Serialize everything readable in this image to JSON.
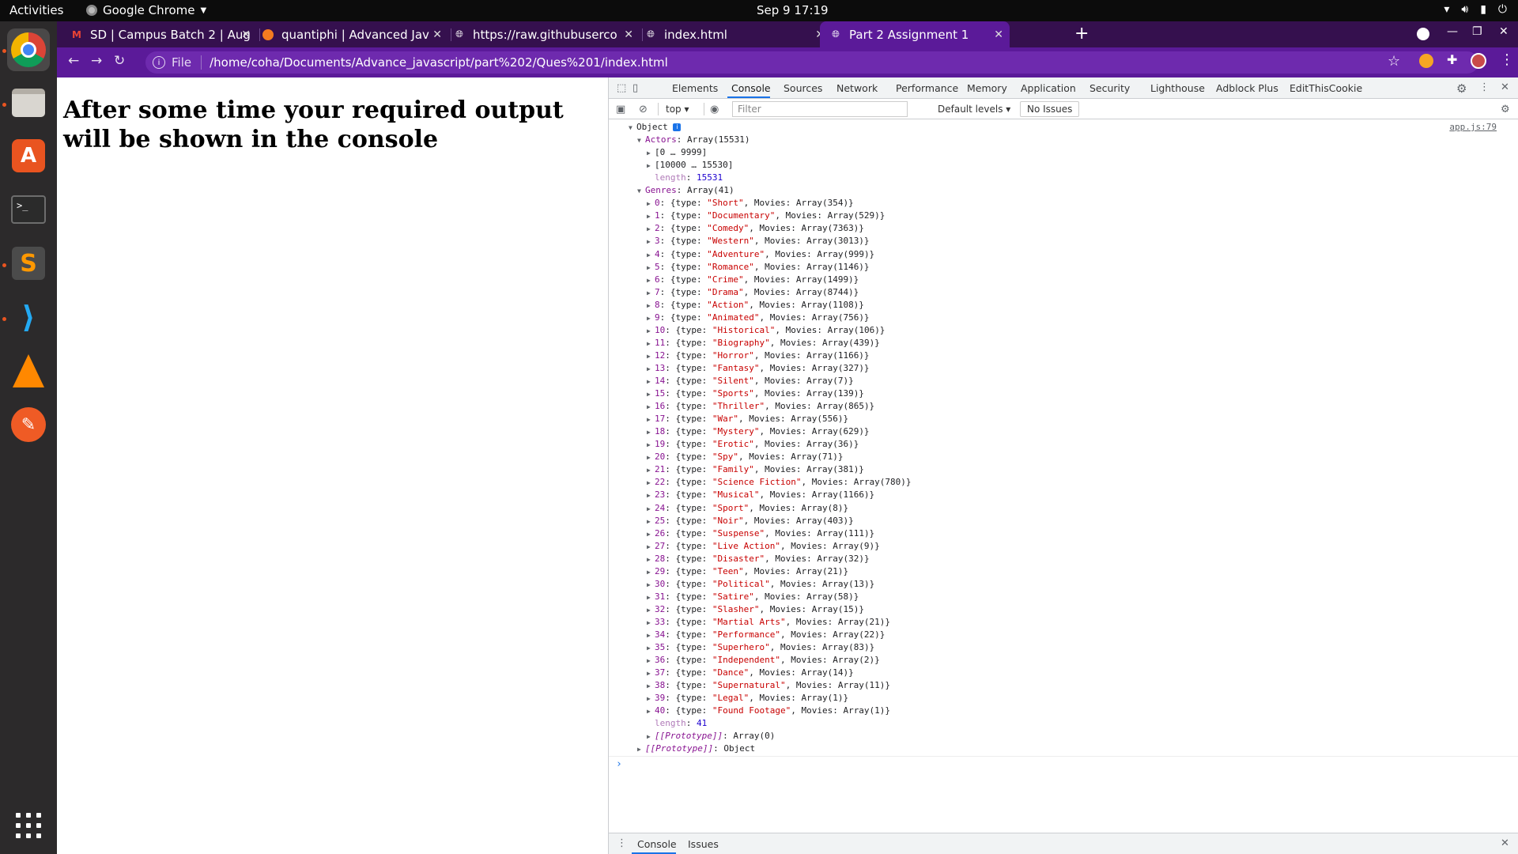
{
  "system": {
    "activities": "Activities",
    "app_name": "Google Chrome",
    "clock": "Sep 9  17:19"
  },
  "dock": [
    {
      "name": "chrome",
      "active": true
    },
    {
      "name": "files"
    },
    {
      "name": "software-store"
    },
    {
      "name": "terminal"
    },
    {
      "name": "sublime-text"
    },
    {
      "name": "vscode"
    },
    {
      "name": "vlc"
    },
    {
      "name": "postman"
    },
    {
      "name": "show-apps"
    }
  ],
  "tabs": [
    {
      "title": "SD | Campus Batch 2 | Aug",
      "icon": "gmail-icon",
      "icon_color": "#ea4335"
    },
    {
      "title": "quantiphi | Advanced Jav",
      "icon": "orange-circle-icon",
      "icon_color": "#f47c20"
    },
    {
      "title": "https://raw.githubuserco",
      "icon": "globe-icon",
      "icon_color": "#ffffff"
    },
    {
      "title": "index.html",
      "icon": "globe-icon",
      "icon_color": "#ffffff"
    },
    {
      "title": "Part 2 Assignment 1",
      "icon": "globe-icon",
      "icon_color": "#ffffff",
      "active": true
    }
  ],
  "address_bar": {
    "scheme": "File",
    "url": "/home/coha/Documents/Advance_javascript/part%202/Ques%201/index.html"
  },
  "page": {
    "heading": "After some time your required output will be shown in the console"
  },
  "devtools": {
    "tabs": [
      "Elements",
      "Console",
      "Sources",
      "Network",
      "Performance",
      "Memory",
      "Application",
      "Security",
      "Lighthouse",
      "Adblock Plus",
      "EditThisCookie"
    ],
    "active_tab": "Console",
    "context": "top",
    "filter_placeholder": "Filter",
    "levels": "Default levels",
    "issues": "No Issues",
    "source_link": "app.js:79",
    "drawer_tabs": [
      "Console",
      "Issues"
    ],
    "colors": {
      "accent": "#1a73e8",
      "prop": "#881391",
      "string": "#c80000",
      "number": "#1c00cf"
    }
  },
  "console": {
    "root_label": "Object",
    "actors_label": "Actors",
    "actors_value": "Array(15531)",
    "actors_chunks": [
      "[0 … 9999]",
      "[10000 … 15530]"
    ],
    "actors_length": "15531",
    "genres_label": "Genres",
    "genres_value": "Array(41)",
    "genres": [
      {
        "type": "Short",
        "count": 354
      },
      {
        "type": "Documentary",
        "count": 529
      },
      {
        "type": "Comedy",
        "count": 7363
      },
      {
        "type": "Western",
        "count": 3013
      },
      {
        "type": "Adventure",
        "count": 999
      },
      {
        "type": "Romance",
        "count": 1146
      },
      {
        "type": "Crime",
        "count": 1499
      },
      {
        "type": "Drama",
        "count": 8744
      },
      {
        "type": "Action",
        "count": 1108
      },
      {
        "type": "Animated",
        "count": 756
      },
      {
        "type": "Historical",
        "count": 106
      },
      {
        "type": "Biography",
        "count": 439
      },
      {
        "type": "Horror",
        "count": 1166
      },
      {
        "type": "Fantasy",
        "count": 327
      },
      {
        "type": "Silent",
        "count": 7
      },
      {
        "type": "Sports",
        "count": 139
      },
      {
        "type": "Thriller",
        "count": 865
      },
      {
        "type": "War",
        "count": 556
      },
      {
        "type": "Mystery",
        "count": 629
      },
      {
        "type": "Erotic",
        "count": 36
      },
      {
        "type": "Spy",
        "count": 71
      },
      {
        "type": "Family",
        "count": 381
      },
      {
        "type": "Science Fiction",
        "count": 780
      },
      {
        "type": "Musical",
        "count": 1166
      },
      {
        "type": "Sport",
        "count": 8
      },
      {
        "type": "Noir",
        "count": 403
      },
      {
        "type": "Suspense",
        "count": 111
      },
      {
        "type": "Live Action",
        "count": 9
      },
      {
        "type": "Disaster",
        "count": 32
      },
      {
        "type": "Teen",
        "count": 21
      },
      {
        "type": "Political",
        "count": 13
      },
      {
        "type": "Satire",
        "count": 58
      },
      {
        "type": "Slasher",
        "count": 15
      },
      {
        "type": "Martial Arts",
        "count": 21
      },
      {
        "type": "Performance",
        "count": 22
      },
      {
        "type": "Superhero",
        "count": 83
      },
      {
        "type": "Independent",
        "count": 2
      },
      {
        "type": "Dance",
        "count": 14
      },
      {
        "type": "Supernatural",
        "count": 11
      },
      {
        "type": "Legal",
        "count": 1
      },
      {
        "type": "Found Footage",
        "count": 1
      }
    ],
    "genres_length": "41",
    "genres_proto": "Array(0)",
    "root_proto": "Object",
    "proto_label": "[[Prototype]]"
  }
}
